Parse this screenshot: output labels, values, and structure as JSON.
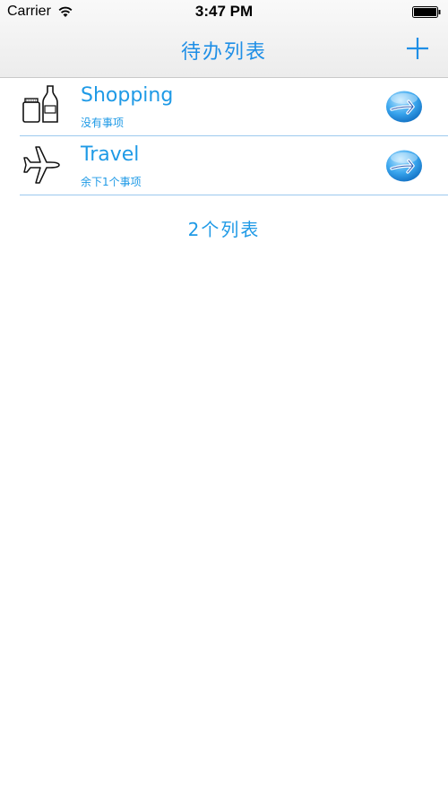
{
  "status_bar": {
    "carrier": "Carrier",
    "time": "3:47 PM",
    "icons": [
      "wifi-icon",
      "battery-icon"
    ]
  },
  "nav": {
    "title": "待办列表",
    "add_icon": "plus-icon",
    "accent": "#1f8fe6"
  },
  "lists": [
    {
      "title": "Shopping",
      "subtitle": "没有事项",
      "icon": "jar-bottle-icon",
      "action_icon": "arrow-right-icon"
    },
    {
      "title": "Travel",
      "subtitle": "余下1个事项",
      "icon": "airplane-icon",
      "action_icon": "arrow-right-icon"
    }
  ],
  "footer": {
    "count_label": "2个列表"
  }
}
